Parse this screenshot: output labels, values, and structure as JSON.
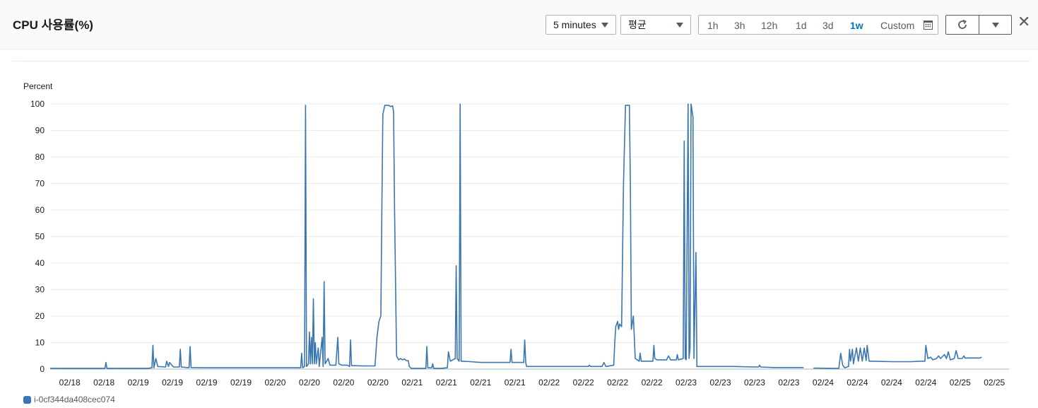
{
  "header": {
    "title": "CPU 사용률(%)",
    "period_label": "5 minutes",
    "stat_label": "평균",
    "ranges": [
      "1h",
      "3h",
      "12h",
      "1d",
      "3d",
      "1w"
    ],
    "active_range": "1w",
    "custom_label": "Custom"
  },
  "chart_data": {
    "type": "line",
    "ylabel": "Percent",
    "ylim": [
      0,
      100
    ],
    "yticks": [
      0,
      10,
      20,
      30,
      40,
      50,
      60,
      70,
      80,
      90,
      100
    ],
    "xticks": [
      "02/18",
      "02/18",
      "02/19",
      "02/19",
      "02/19",
      "02/19",
      "02/20",
      "02/20",
      "02/20",
      "02/20",
      "02/21",
      "02/21",
      "02/21",
      "02/21",
      "02/22",
      "02/22",
      "02/22",
      "02/22",
      "02/23",
      "02/23",
      "02/23",
      "02/23",
      "02/24",
      "02/24",
      "02/24",
      "02/24",
      "02/25",
      "02/25"
    ],
    "grid": true,
    "color": "#3a76b0",
    "series": [
      {
        "name": "i-0cf344da408cec074",
        "segments": [
          [
            [
              0,
              0.3
            ],
            [
              1,
              0.3
            ],
            [
              2,
              0.3
            ],
            [
              2.8,
              0.3
            ],
            [
              2.85,
              2.5
            ],
            [
              2.9,
              0.3
            ],
            [
              5,
              0.3
            ],
            [
              5.2,
              0.5
            ],
            [
              5.25,
              9
            ],
            [
              5.3,
              0.5
            ],
            [
              5.4,
              4
            ],
            [
              5.5,
              1
            ],
            [
              5.9,
              0.8
            ],
            [
              5.95,
              3
            ],
            [
              6.05,
              1
            ],
            [
              6.1,
              2.5
            ],
            [
              6.3,
              0.8
            ],
            [
              6.6,
              0.8
            ],
            [
              6.65,
              7.5
            ],
            [
              6.7,
              0.8
            ],
            [
              7,
              0.6
            ],
            [
              7.1,
              0.6
            ],
            [
              7.15,
              8.5
            ],
            [
              7.2,
              0.6
            ],
            [
              8,
              0.5
            ],
            [
              9,
              0.5
            ],
            [
              10,
              0.5
            ],
            [
              11,
              0.5
            ],
            [
              12,
              0.5
            ],
            [
              12.8,
              0.5
            ],
            [
              12.85,
              6
            ],
            [
              12.9,
              0.5
            ],
            [
              13,
              1
            ],
            [
              13.05,
              99.5
            ],
            [
              13.1,
              1
            ],
            [
              13.2,
              2
            ],
            [
              13.25,
              14
            ],
            [
              13.3,
              2
            ],
            [
              13.35,
              12
            ],
            [
              13.4,
              2
            ],
            [
              13.45,
              26.5
            ],
            [
              13.5,
              2
            ],
            [
              13.55,
              10
            ],
            [
              13.6,
              2
            ],
            [
              13.7,
              8
            ],
            [
              13.75,
              1
            ],
            [
              13.9,
              12
            ],
            [
              13.95,
              1
            ],
            [
              14,
              33
            ],
            [
              14.05,
              2
            ],
            [
              14.2,
              4
            ],
            [
              14.3,
              1.5
            ],
            [
              14.6,
              1.5
            ],
            [
              14.7,
              12
            ],
            [
              14.75,
              2
            ],
            [
              14.9,
              1.5
            ],
            [
              15.2,
              1.5
            ],
            [
              15.3,
              1
            ],
            [
              15.35,
              11
            ],
            [
              15.4,
              1.3
            ],
            [
              16,
              1.2
            ],
            [
              16.4,
              1.2
            ],
            [
              16.6,
              1.2
            ],
            [
              16.7,
              12
            ],
            [
              16.8,
              18
            ],
            [
              16.9,
              20
            ],
            [
              16.95,
              60
            ],
            [
              17.0,
              96
            ],
            [
              17.1,
              99.5
            ],
            [
              17.3,
              99.5
            ],
            [
              17.4,
              99
            ],
            [
              17.5,
              99.3
            ],
            [
              17.55,
              97
            ],
            [
              17.6,
              60
            ],
            [
              17.7,
              5
            ],
            [
              17.8,
              3.5
            ],
            [
              17.9,
              4
            ],
            [
              18.0,
              3.5
            ],
            [
              18.1,
              3.8
            ],
            [
              18.2,
              3.2
            ],
            [
              18.3,
              3.2
            ],
            [
              18.35,
              1
            ],
            [
              18.45,
              0.3
            ],
            [
              19,
              0.3
            ],
            [
              19.2,
              0.3
            ],
            [
              19.25,
              8.5
            ],
            [
              19.3,
              0.5
            ],
            [
              19.5,
              0.5
            ],
            [
              19.55,
              2
            ],
            [
              19.6,
              0.3
            ],
            [
              20,
              0.3
            ],
            [
              20.3,
              0.5
            ],
            [
              20.35,
              6.5
            ],
            [
              20.45,
              3
            ],
            [
              20.7,
              4
            ],
            [
              20.75,
              39
            ],
            [
              20.8,
              4
            ],
            [
              20.9,
              3
            ],
            [
              20.95,
              100
            ],
            [
              21.0,
              3
            ],
            [
              21.5,
              2.8
            ],
            [
              22,
              2.5
            ],
            [
              23,
              2.5
            ],
            [
              23.5,
              2.5
            ],
            [
              23.55,
              7.5
            ],
            [
              23.6,
              2.5
            ],
            [
              24,
              2.5
            ],
            [
              24.2,
              2.5
            ],
            [
              24.25,
              11
            ],
            [
              24.3,
              2.5
            ],
            [
              24.35,
              1
            ],
            [
              25,
              1
            ],
            [
              26,
              1
            ],
            [
              27,
              1
            ],
            [
              27.5,
              1
            ],
            [
              27.55,
              1.5
            ],
            [
              27.6,
              1
            ],
            [
              28,
              1
            ],
            [
              28.2,
              1
            ],
            [
              28.3,
              2.5
            ],
            [
              28.4,
              1
            ],
            [
              28.8,
              1.5
            ],
            [
              28.85,
              10
            ],
            [
              28.9,
              16
            ],
            [
              29,
              18
            ],
            [
              29.05,
              15
            ],
            [
              29.1,
              17
            ],
            [
              29.2,
              16
            ],
            [
              29.3,
              70
            ],
            [
              29.4,
              99.5
            ],
            [
              29.6,
              99.5
            ],
            [
              29.65,
              70
            ],
            [
              29.7,
              15
            ],
            [
              29.8,
              20
            ],
            [
              29.85,
              12
            ],
            [
              29.9,
              4
            ],
            [
              30.1,
              3
            ],
            [
              30.15,
              6
            ],
            [
              30.2,
              3
            ],
            [
              30.8,
              3
            ],
            [
              30.85,
              9
            ],
            [
              30.9,
              4
            ],
            [
              31,
              3.5
            ],
            [
              31.5,
              3.5
            ],
            [
              31.6,
              5
            ],
            [
              31.7,
              3.5
            ],
            [
              32.0,
              3.5
            ],
            [
              32.05,
              5.5
            ],
            [
              32.1,
              3.5
            ],
            [
              32.35,
              4
            ],
            [
              32.4,
              86
            ],
            [
              32.45,
              4
            ],
            [
              32.5,
              3.5
            ],
            [
              32.6,
              100
            ],
            [
              32.65,
              4
            ],
            [
              32.7,
              8
            ],
            [
              32.75,
              100
            ],
            [
              32.85,
              95
            ],
            [
              32.9,
              4
            ],
            [
              33.0,
              44
            ],
            [
              33.05,
              1
            ],
            [
              33.2,
              1
            ],
            [
              34,
              1
            ],
            [
              35,
              1
            ],
            [
              36,
              0.8
            ],
            [
              36.2,
              0.8
            ],
            [
              36.25,
              1.5
            ],
            [
              36.3,
              0.8
            ],
            [
              37,
              0.6
            ],
            [
              38,
              0.6
            ],
            [
              38.5,
              0.6
            ]
          ],
          [
            [
              39.0,
              0.4
            ],
            [
              40,
              0.3
            ],
            [
              40.3,
              0.3
            ],
            [
              40.4,
              6
            ],
            [
              40.5,
              1.5
            ],
            [
              40.6,
              0.5
            ],
            [
              40.8,
              1
            ],
            [
              40.85,
              7.5
            ],
            [
              40.9,
              3
            ],
            [
              41.0,
              7.5
            ],
            [
              41.05,
              2
            ],
            [
              41.2,
              8
            ],
            [
              41.3,
              3
            ],
            [
              41.4,
              8
            ],
            [
              41.5,
              3
            ],
            [
              41.6,
              8
            ],
            [
              41.7,
              3.2
            ],
            [
              41.75,
              9
            ],
            [
              41.85,
              3
            ],
            [
              42,
              3
            ],
            [
              43,
              2.8
            ],
            [
              44,
              2.8
            ],
            [
              44.5,
              3
            ],
            [
              44.7,
              3
            ],
            [
              44.75,
              9
            ],
            [
              44.85,
              4
            ],
            [
              45,
              4.5
            ],
            [
              45.1,
              3.5
            ],
            [
              45.3,
              4
            ],
            [
              45.4,
              5
            ],
            [
              45.5,
              4
            ],
            [
              45.7,
              5.5
            ],
            [
              45.8,
              4
            ],
            [
              45.9,
              6.5
            ],
            [
              46.0,
              3.5
            ],
            [
              46.2,
              4
            ],
            [
              46.3,
              7
            ],
            [
              46.4,
              4
            ],
            [
              46.6,
              4
            ],
            [
              46.7,
              5
            ],
            [
              46.75,
              4.2
            ],
            [
              47.5,
              4.2
            ],
            [
              47.6,
              4.5
            ]
          ]
        ]
      }
    ]
  }
}
